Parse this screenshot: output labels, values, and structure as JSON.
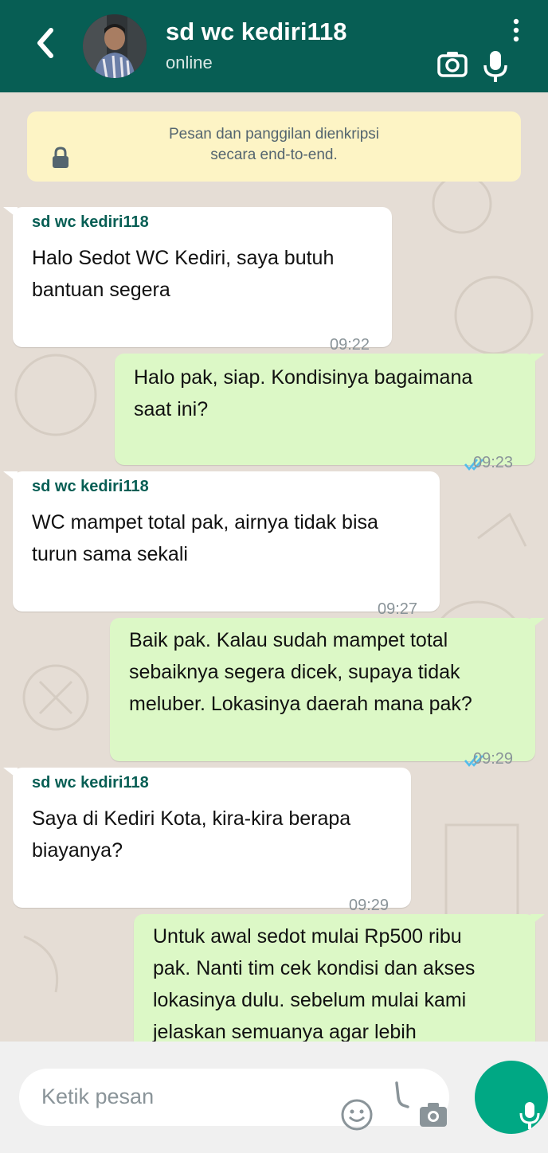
{
  "header": {
    "contact_name": "sd wc kediri118",
    "status": "online",
    "icons": [
      "chevron-left-icon",
      "avatar",
      "camera-icon",
      "mic-icon",
      "more-vert-icon"
    ]
  },
  "encryption_notice": {
    "line1": "Pesan dan panggilan dienkripsi",
    "line2": "secara end-to-end."
  },
  "messages": [
    {
      "direction": "in",
      "sender": "sd wc kediri118",
      "lines": [
        "Halo Sedot WC Kediri, saya butuh",
        "bantuan segera"
      ],
      "time": "09:22"
    },
    {
      "direction": "out",
      "lines": [
        "Halo pak, siap. Kondisinya bagaimana",
        "saat ini?"
      ],
      "time": "09:23",
      "read": true
    },
    {
      "direction": "in",
      "sender": "sd wc kediri118",
      "lines": [
        "WC mampet total pak, airnya tidak bisa",
        "turun sama sekali"
      ],
      "time": "09:27"
    },
    {
      "direction": "out",
      "lines": [
        "Baik pak. Kalau sudah mampet total",
        "sebaiknya segera dicek, supaya tidak",
        "meluber. Lokasinya daerah mana pak?"
      ],
      "time": "09:29",
      "read": true
    },
    {
      "direction": "in",
      "sender": "sd wc kediri118",
      "lines": [
        "Saya di Kediri Kota, kira-kira berapa",
        "biayanya?"
      ],
      "time": "09:29"
    },
    {
      "direction": "out",
      "lines": [
        "Untuk awal sedot mulai Rp500 ribu",
        "pak. Nanti tim cek kondisi dan akses",
        "lokasinya dulu. sebelum mulai kami",
        "jelaskan semuanya agar lebih"
      ],
      "time": ""
    }
  ],
  "input": {
    "placeholder": "Ketik pesan"
  },
  "colors": {
    "header": "#075e54",
    "outgoing_bubble": "#dcf8c6",
    "incoming_bubble": "#ffffff",
    "chat_background": "#e5ddd5",
    "notice_background": "#fdf4c5",
    "send_button": "#00a884",
    "read_ticks": "#53bdeb"
  }
}
